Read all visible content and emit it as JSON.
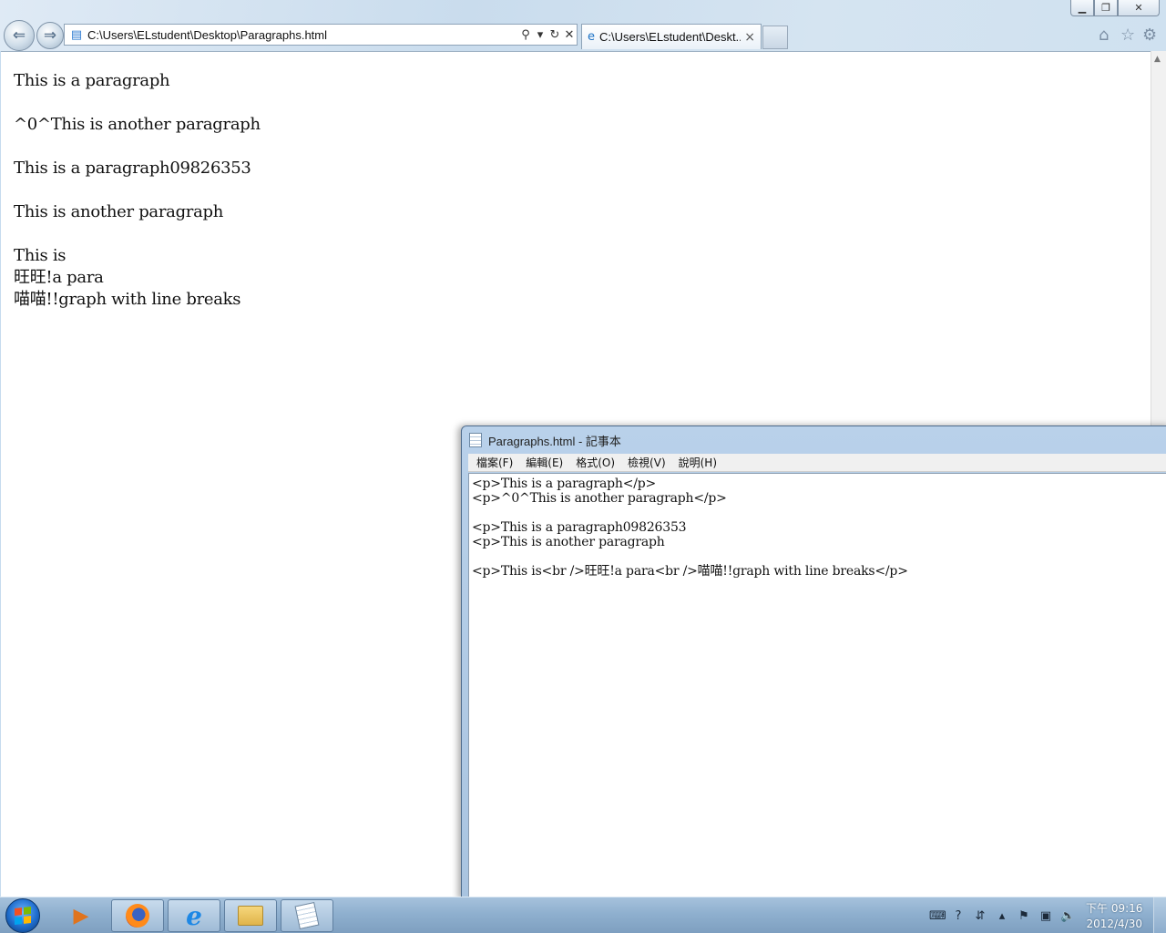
{
  "ie": {
    "address": "C:\\Users\\ELstudent\\Desktop\\Paragraphs.html",
    "tab_title": "C:\\Users\\ELstudent\\Deskt...",
    "back_glyph": "⇐",
    "forward_glyph": "⇒",
    "content_paragraphs": [
      [
        "This is a paragraph"
      ],
      [
        "^0^This is another paragraph"
      ],
      [
        "This is a paragraph09826353"
      ],
      [
        "This is another paragraph"
      ],
      [
        "This is",
        "旺旺!a para",
        "喵喵!!graph with line breaks"
      ]
    ]
  },
  "notepad": {
    "title": "Paragraphs.html - 記事本",
    "menu": [
      "檔案(F)",
      "編輯(E)",
      "格式(O)",
      "檢視(V)",
      "說明(H)"
    ],
    "text": "<p>This is a paragraph</p>\n<p>^0^This is another paragraph</p>\n\n<p>This is a paragraph09826353\n<p>This is another paragraph\n\n<p>This is<br />旺旺!a para<br />喵喵!!graph with line breaks</p>"
  },
  "taskbar": {
    "clock_time": "下午 09:16",
    "clock_date": "2012/4/30"
  }
}
